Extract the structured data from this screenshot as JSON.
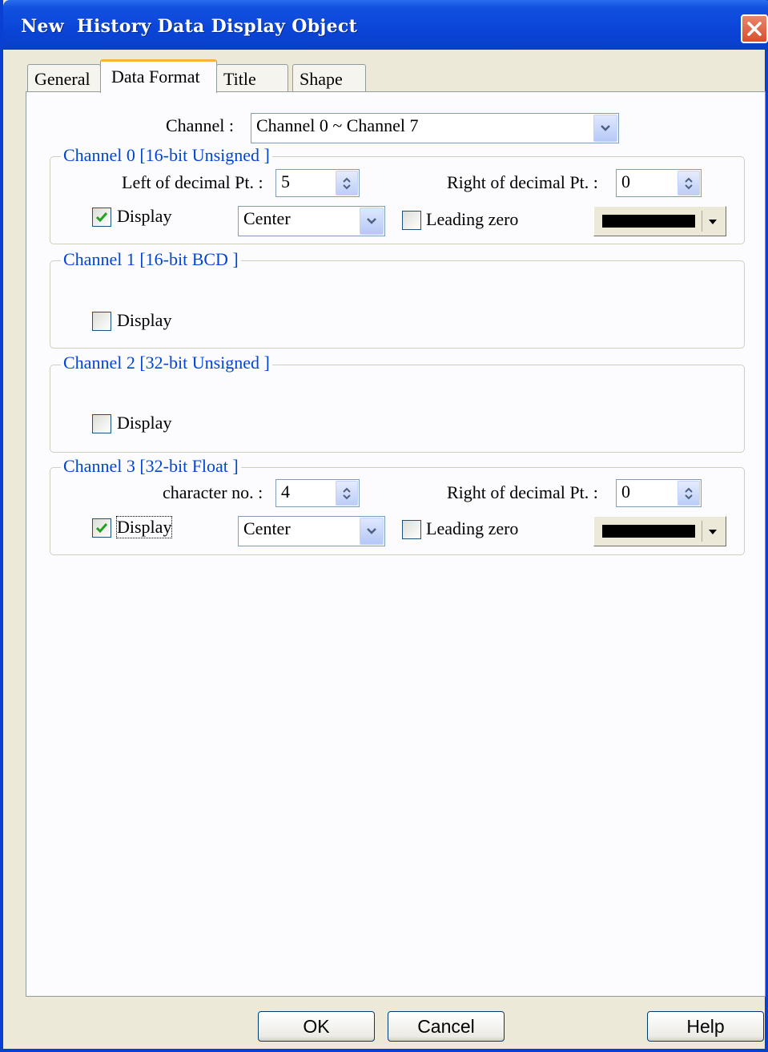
{
  "window": {
    "title": "New  History Data Display Object"
  },
  "tabs": [
    {
      "label": "General",
      "active": false
    },
    {
      "label": "Data Format",
      "active": true
    },
    {
      "label": "Title",
      "active": false
    },
    {
      "label": "Shape",
      "active": false
    }
  ],
  "channel_select": {
    "label": "Channel :",
    "value": "Channel 0 ~ Channel 7"
  },
  "channels": [
    {
      "title": "Channel 0 [16-bit Unsigned ]",
      "left_label": "Left of decimal Pt. :",
      "left_value": "5",
      "right_label": "Right of decimal Pt. :",
      "right_value": "0",
      "display_label": "Display",
      "display_checked": true,
      "align_value": "Center",
      "leading_zero_label": "Leading zero",
      "leading_zero_checked": false,
      "color": "#000000"
    },
    {
      "title": "Channel 1 [16-bit BCD ]",
      "display_label": "Display",
      "display_checked": false
    },
    {
      "title": "Channel 2 [32-bit Unsigned ]",
      "display_label": "Display",
      "display_checked": false
    },
    {
      "title": "Channel 3 [32-bit Float ]",
      "left_label": "character no. :",
      "left_value": "4",
      "right_label": "Right of decimal Pt. :",
      "right_value": "0",
      "display_label": "Display",
      "display_checked": true,
      "align_value": "Center",
      "leading_zero_label": "Leading zero",
      "leading_zero_checked": false,
      "color": "#000000"
    }
  ],
  "buttons": {
    "ok": "OK",
    "cancel": "Cancel",
    "help": "Help"
  },
  "colors": {
    "titlebar": "#0a45d8",
    "group_title": "#0046d5",
    "tab_highlight": "#f8b33a",
    "checkmark": "#21a121"
  },
  "icons": {
    "close": "close-icon",
    "dropdown": "chevron-down-icon",
    "spinner": "spinner-updown-icon",
    "check": "checkmark-icon"
  }
}
